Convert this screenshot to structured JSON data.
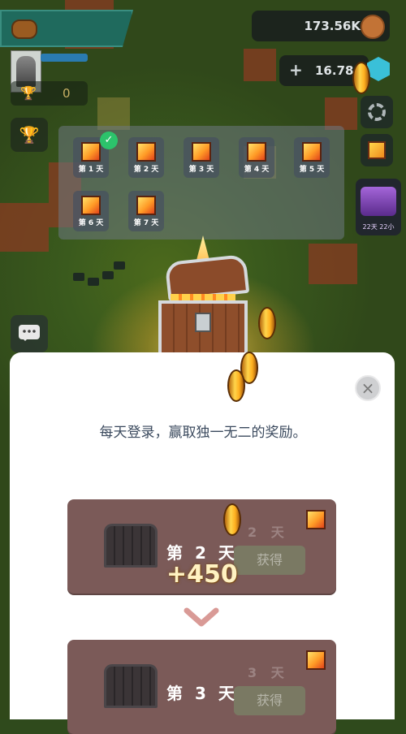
{
  "hud": {
    "trophy_count": "0",
    "currency_amount": "173.56K",
    "gem_amount": "16.78",
    "gem_add_label": "+",
    "event_timer": "22天 22小"
  },
  "calendar": {
    "days": [
      {
        "label": "第 1 天",
        "claimed": true
      },
      {
        "label": "第 2 天",
        "claimed": false
      },
      {
        "label": "第 3 天",
        "claimed": false
      },
      {
        "label": "第 4 天",
        "claimed": false
      },
      {
        "label": "第 5 天",
        "claimed": false
      },
      {
        "label": "第 6 天",
        "claimed": false
      },
      {
        "label": "第 7 天",
        "claimed": false
      }
    ]
  },
  "modal": {
    "close_symbol": "×",
    "message": "每天登录，赢取独一无二的奖励。",
    "cards": [
      {
        "day_label": "第 2 天",
        "ghost_label": "2 天",
        "claim_label": "获得"
      },
      {
        "day_label": "第 3 天",
        "ghost_label": "3 天",
        "claim_label": "获得"
      }
    ],
    "reward_popup": "+450"
  },
  "icons": {
    "token": "token-icon",
    "coin": "coin-icon",
    "gem": "gem-icon",
    "gear": "gear-icon",
    "chat": "chat-icon",
    "trophy": "trophy-icon",
    "check": "check-icon",
    "chest": "treasure-chest-icon",
    "cube": "reward-cube-icon",
    "chevron": "chevron-down-icon",
    "close": "close-icon"
  },
  "colors": {
    "accent_teal": "#1f6a5d",
    "claim_green": "#2cc36b",
    "card_brown": "#7b5a58",
    "chevron_pink": "#d99a96"
  }
}
